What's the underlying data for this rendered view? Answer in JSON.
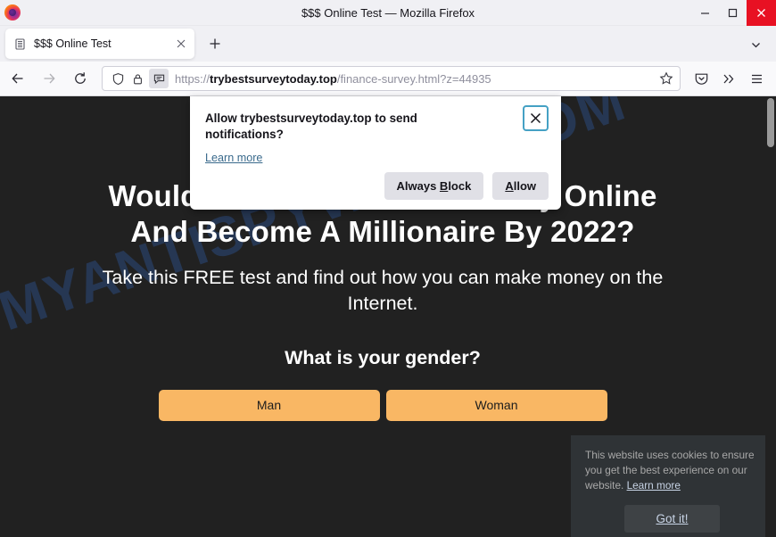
{
  "window": {
    "title": "$$$ Online Test — Mozilla Firefox",
    "minimize_label": "Minimize",
    "maximize_label": "Maximize",
    "close_label": "Close"
  },
  "tabbar": {
    "tab_title": "$$$ Online Test",
    "tab_close_label": "×",
    "new_tab_label": "+",
    "list_all_tabs_label": "List all tabs"
  },
  "toolbar": {
    "back_label": "Back",
    "forward_label": "Forward",
    "reload_label": "Reload",
    "url_scheme": "https://",
    "url_host": "trybestsurveytoday.top",
    "url_path": "/finance-survey.html?z=44935",
    "url_full": "https://trybestsurveytoday.top/finance-survey.html?z=44935",
    "bookmark_label": "Bookmark this page",
    "pocket_label": "Save to Pocket",
    "overflow_label": "More tools",
    "menu_label": "Open application menu"
  },
  "doorhanger": {
    "title": "Allow trybestsurveytoday.top to send notifications?",
    "learn_more": "Learn more",
    "close_label": "×",
    "always_block": {
      "pre": "Always ",
      "key": "B",
      "post": "lock"
    },
    "allow": {
      "key": "A",
      "post": "llow"
    }
  },
  "page": {
    "background": "#212121",
    "watermark": "MYANTISPYWARE.COM",
    "headline_line1": "Would You Like To Make Money Online And",
    "headline_line2": "Become A Millionaire By 2022?",
    "subline_line1": "Take this FREE test and find out how you can make money",
    "subline_line2": "on the Internet.",
    "question": "What is your gender?",
    "choice_man": "Man",
    "choice_woman": "Woman",
    "accent_button_color": "#f9b764"
  },
  "cookie_banner": {
    "text": "This website uses cookies to ensure you get the best experience on our website. ",
    "learn_more": "Learn more",
    "button": "Got it!"
  }
}
